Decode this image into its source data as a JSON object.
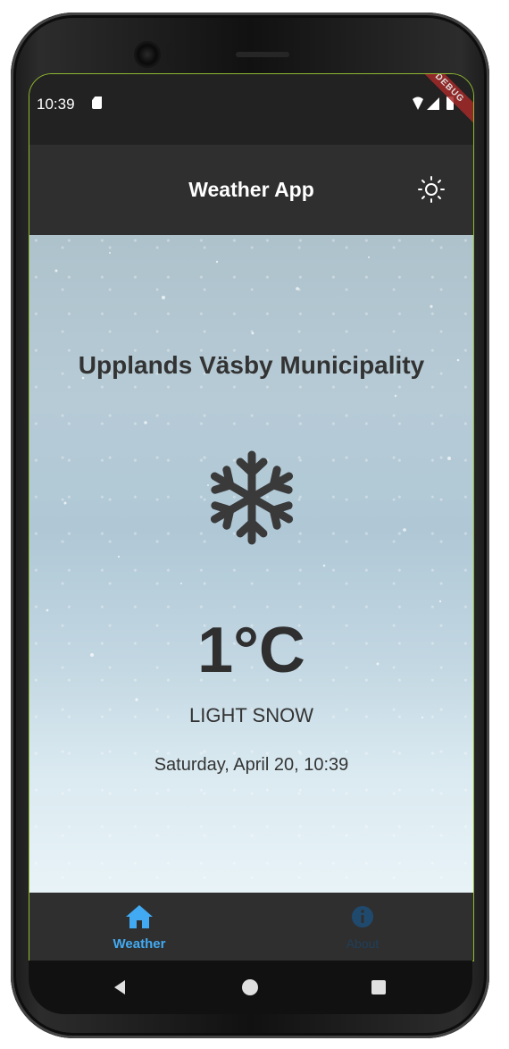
{
  "status_bar": {
    "time": "10:39",
    "debug_label": "DEBUG"
  },
  "app_bar": {
    "title": "Weather App",
    "theme_icon": "sun-icon"
  },
  "weather": {
    "location": "Upplands Väsby Municipality",
    "icon": "snowflake-icon",
    "temperature": "1°C",
    "description": "LIGHT SNOW",
    "datetime": "Saturday, April 20, 10:39"
  },
  "bottom_nav": {
    "items": [
      {
        "label": "Weather",
        "icon": "home-icon",
        "active": true,
        "color": "#42aaf2"
      },
      {
        "label": "About",
        "icon": "info-icon",
        "active": false,
        "color": "#1f3f5a"
      }
    ]
  },
  "colors": {
    "status_bar_bg": "#222222",
    "app_bar_bg": "#2f2f2f",
    "nav_bg": "#2f2f2f",
    "text_dark": "#333333",
    "accent": "#42aaf2"
  },
  "system_nav": {
    "back_icon": "back-triangle-icon",
    "home_icon": "home-circle-icon",
    "recents_icon": "recents-square-icon"
  }
}
